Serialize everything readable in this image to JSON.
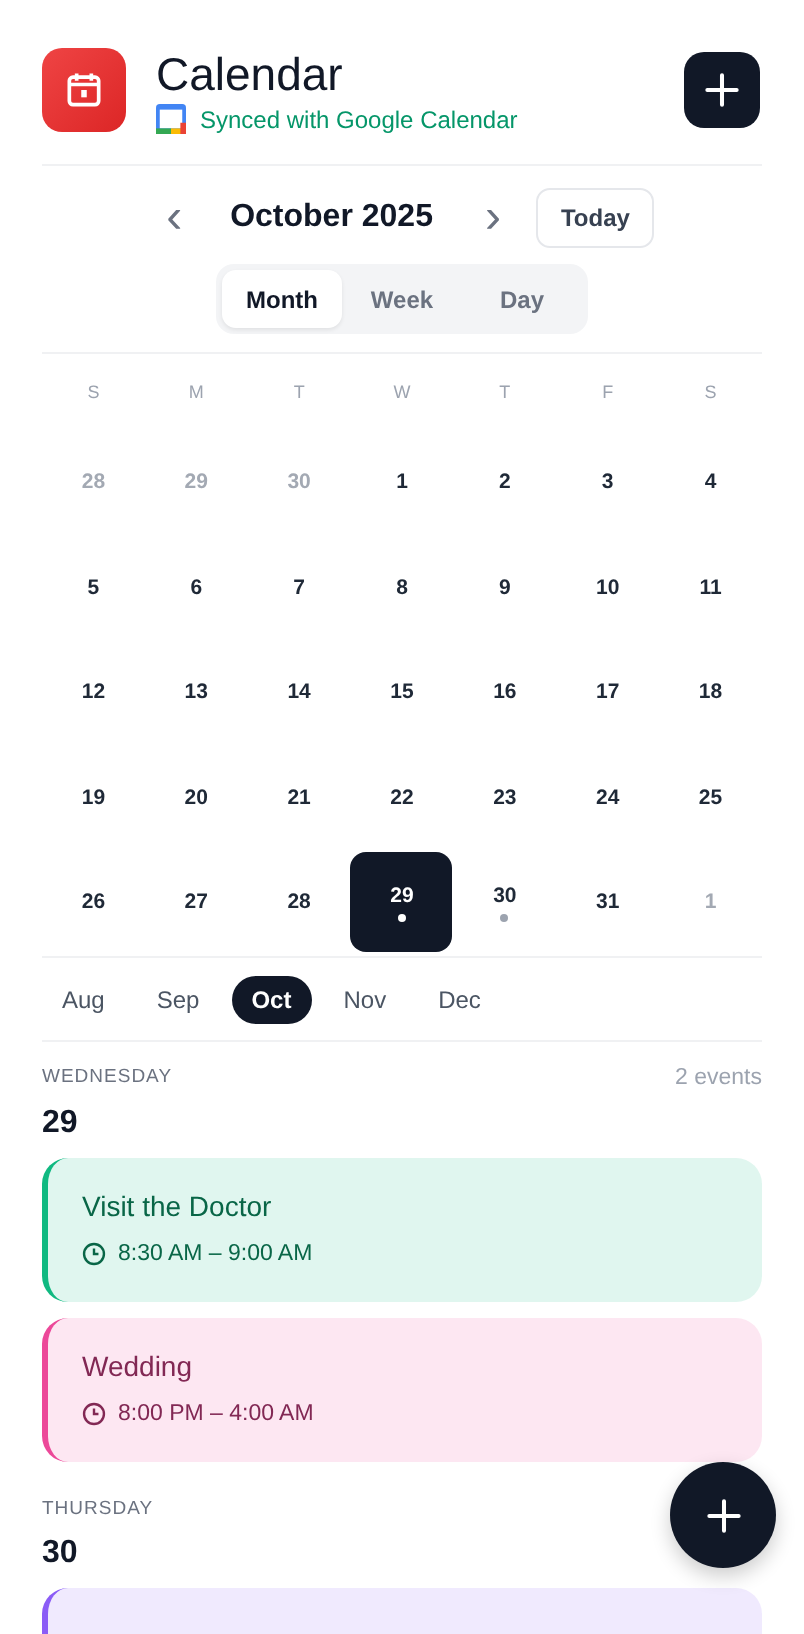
{
  "header": {
    "title": "Calendar",
    "sync_label": "Synced with Google Calendar"
  },
  "nav": {
    "prev": "‹",
    "month": "October 2025",
    "next": "›",
    "today": "Today"
  },
  "views": [
    {
      "label": "Month",
      "selected": true
    },
    {
      "label": "Week",
      "selected": false
    },
    {
      "label": "Day",
      "selected": false
    }
  ],
  "weekdays": [
    "S",
    "M",
    "T",
    "W",
    "T",
    "F",
    "S"
  ],
  "days": [
    {
      "label": "28",
      "muted": true,
      "selected": false,
      "dot": false
    },
    {
      "label": "29",
      "muted": true,
      "selected": false,
      "dot": false
    },
    {
      "label": "30",
      "muted": true,
      "selected": false,
      "dot": false
    },
    {
      "label": "1",
      "muted": false,
      "selected": false,
      "dot": false
    },
    {
      "label": "2",
      "muted": false,
      "selected": false,
      "dot": false
    },
    {
      "label": "3",
      "muted": false,
      "selected": false,
      "dot": false
    },
    {
      "label": "4",
      "muted": false,
      "selected": false,
      "dot": false
    },
    {
      "label": "5",
      "muted": false,
      "selected": false,
      "dot": false
    },
    {
      "label": "6",
      "muted": false,
      "selected": false,
      "dot": false
    },
    {
      "label": "7",
      "muted": false,
      "selected": false,
      "dot": false
    },
    {
      "label": "8",
      "muted": false,
      "selected": false,
      "dot": false
    },
    {
      "label": "9",
      "muted": false,
      "selected": false,
      "dot": false
    },
    {
      "label": "10",
      "muted": false,
      "selected": false,
      "dot": false
    },
    {
      "label": "11",
      "muted": false,
      "selected": false,
      "dot": false
    },
    {
      "label": "12",
      "muted": false,
      "selected": false,
      "dot": false
    },
    {
      "label": "13",
      "muted": false,
      "selected": false,
      "dot": false
    },
    {
      "label": "14",
      "muted": false,
      "selected": false,
      "dot": false
    },
    {
      "label": "15",
      "muted": false,
      "selected": false,
      "dot": false
    },
    {
      "label": "16",
      "muted": false,
      "selected": false,
      "dot": false
    },
    {
      "label": "17",
      "muted": false,
      "selected": false,
      "dot": false
    },
    {
      "label": "18",
      "muted": false,
      "selected": false,
      "dot": false
    },
    {
      "label": "19",
      "muted": false,
      "selected": false,
      "dot": false
    },
    {
      "label": "20",
      "muted": false,
      "selected": false,
      "dot": false
    },
    {
      "label": "21",
      "muted": false,
      "selected": false,
      "dot": false
    },
    {
      "label": "22",
      "muted": false,
      "selected": false,
      "dot": false
    },
    {
      "label": "23",
      "muted": false,
      "selected": false,
      "dot": false
    },
    {
      "label": "24",
      "muted": false,
      "selected": false,
      "dot": false
    },
    {
      "label": "25",
      "muted": false,
      "selected": false,
      "dot": false
    },
    {
      "label": "26",
      "muted": false,
      "selected": false,
      "dot": false
    },
    {
      "label": "27",
      "muted": false,
      "selected": false,
      "dot": false
    },
    {
      "label": "28",
      "muted": false,
      "selected": false,
      "dot": false
    },
    {
      "label": "29",
      "muted": false,
      "selected": true,
      "dot": true
    },
    {
      "label": "30",
      "muted": false,
      "selected": false,
      "dot": true
    },
    {
      "label": "31",
      "muted": false,
      "selected": false,
      "dot": false
    },
    {
      "label": "1",
      "muted": true,
      "selected": false,
      "dot": false
    }
  ],
  "months": [
    {
      "label": "Aug",
      "selected": false
    },
    {
      "label": "Sep",
      "selected": false
    },
    {
      "label": "Oct",
      "selected": true
    },
    {
      "label": "Nov",
      "selected": false
    },
    {
      "label": "Dec",
      "selected": false
    }
  ],
  "agenda": [
    {
      "weekday": "WEDNESDAY",
      "date": "29",
      "count": "2 events",
      "events": [
        {
          "title": "Visit the Doctor",
          "time": "8:30 AM – 9:00 AM",
          "color": "#10b981"
        },
        {
          "title": "Wedding",
          "time": "8:00 PM – 4:00 AM",
          "color": "#ec4899"
        }
      ]
    },
    {
      "weekday": "THURSDAY",
      "date": "30",
      "events": [
        {
          "color": "#8b5cf6"
        }
      ]
    }
  ]
}
